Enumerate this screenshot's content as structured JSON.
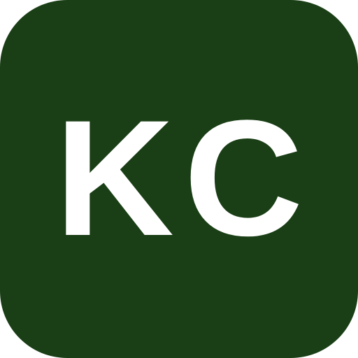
{
  "icon": {
    "initials": "KC",
    "background_color": "#1a3f16",
    "text_color": "#ffffff"
  }
}
